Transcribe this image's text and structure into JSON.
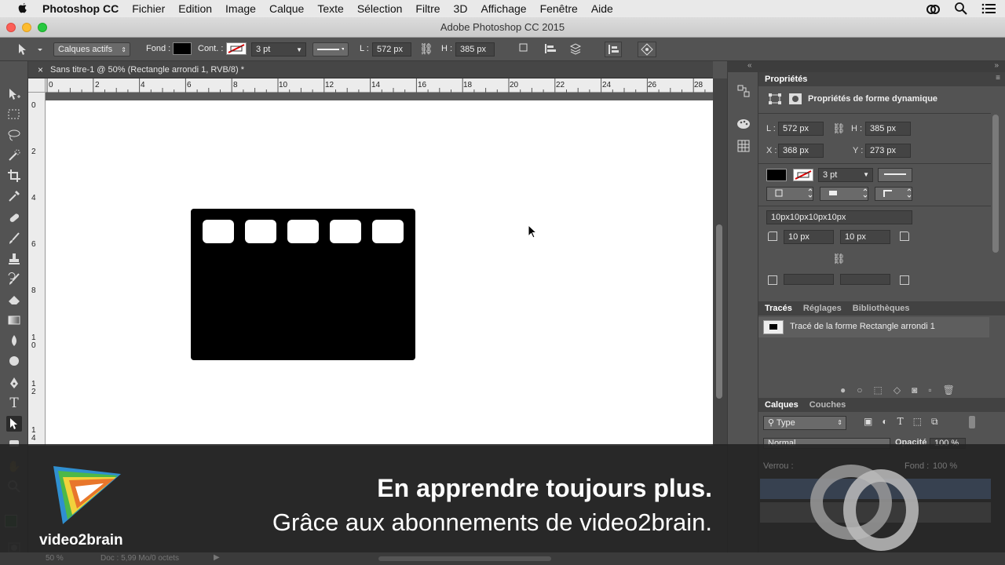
{
  "menubar": {
    "app_name": "Photoshop CC",
    "items": [
      "Fichier",
      "Edition",
      "Image",
      "Calque",
      "Texte",
      "Sélection",
      "Filtre",
      "3D",
      "Affichage",
      "Fenêtre",
      "Aide"
    ]
  },
  "window": {
    "title": "Adobe Photoshop CC 2015"
  },
  "options_bar": {
    "mode": "Calques actifs",
    "fill_label": "Fond :",
    "stroke_label": "Cont. :",
    "stroke_width": "3 pt",
    "width_label": "L :",
    "width_value": "572 px",
    "height_label": "H :",
    "height_value": "385 px"
  },
  "document": {
    "tab_title": "Sans titre-1 @ 50% (Rectangle arrondi 1, RVB/8) *",
    "hruler_ticks": [
      "0",
      "2",
      "4",
      "6",
      "8",
      "10",
      "12",
      "14",
      "16",
      "18",
      "20",
      "22",
      "24",
      "26",
      "28"
    ],
    "vruler_ticks": [
      "0",
      "2",
      "4",
      "6",
      "8",
      "1\n0",
      "1\n2",
      "1\n4"
    ],
    "zoom": "50 %",
    "doc_info": "Doc : 5,99 Mo/0 octets"
  },
  "properties": {
    "header": "Propriétés",
    "subtitle": "Propriétés de forme dynamique",
    "w_label": "L :",
    "w_value": "572 px",
    "h_label": "H :",
    "h_value": "385 px",
    "x_label": "X :",
    "x_value": "368 px",
    "y_label": "Y :",
    "y_value": "273 px",
    "stroke_width": "3 pt",
    "radii_text": "10px10px10px10px",
    "radius_tl": "10 px",
    "radius_tr": "10 px"
  },
  "paths_panel": {
    "tabs": [
      "Tracés",
      "Réglages",
      "Bibliothèques"
    ],
    "item": "Tracé de la forme Rectangle arrondi 1"
  },
  "layers_panel": {
    "tabs": [
      "Calques",
      "Couches"
    ],
    "filter": "Type",
    "blend_mode": "Normal",
    "opacity_label": "Opacité :",
    "opacity_value": "100 %",
    "lock_label": "Verrou :",
    "fill_label": "Fond :",
    "fill_value": "100 %"
  },
  "banner": {
    "line1": "En apprendre toujours plus.",
    "line2": "Grâce aux abonnements de video2brain.",
    "brand": "video2brain"
  },
  "colors": {
    "brand_yellow": "#f2d23c",
    "brand_orange": "#e8762b",
    "brand_green": "#4db848",
    "brand_blue": "#2f8fd0"
  }
}
